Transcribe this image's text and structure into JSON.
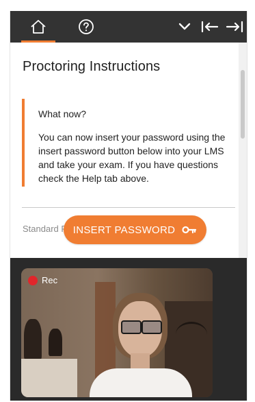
{
  "topbar": {
    "tabs": [
      {
        "name": "home",
        "icon": "home-icon",
        "active": true
      },
      {
        "name": "help",
        "icon": "help-icon",
        "active": false
      }
    ],
    "controls": [
      "chevron-down-icon",
      "arrow-left-bar-icon",
      "arrow-right-bar-icon"
    ]
  },
  "instructions": {
    "title": "Proctoring Instructions",
    "notice_heading": "What now?",
    "notice_body": "You can now insert your password using the insert password button below into your LMS and take your exam. If you have questions check the Help tab above.",
    "standard_label": "Standard R"
  },
  "insert_button": {
    "label": "INSERT PASSWORD",
    "icon": "key-icon"
  },
  "camera": {
    "rec_label": "Rec"
  },
  "colors": {
    "accent": "#f07d32",
    "topbar": "#333333",
    "rec": "#e0262b"
  }
}
